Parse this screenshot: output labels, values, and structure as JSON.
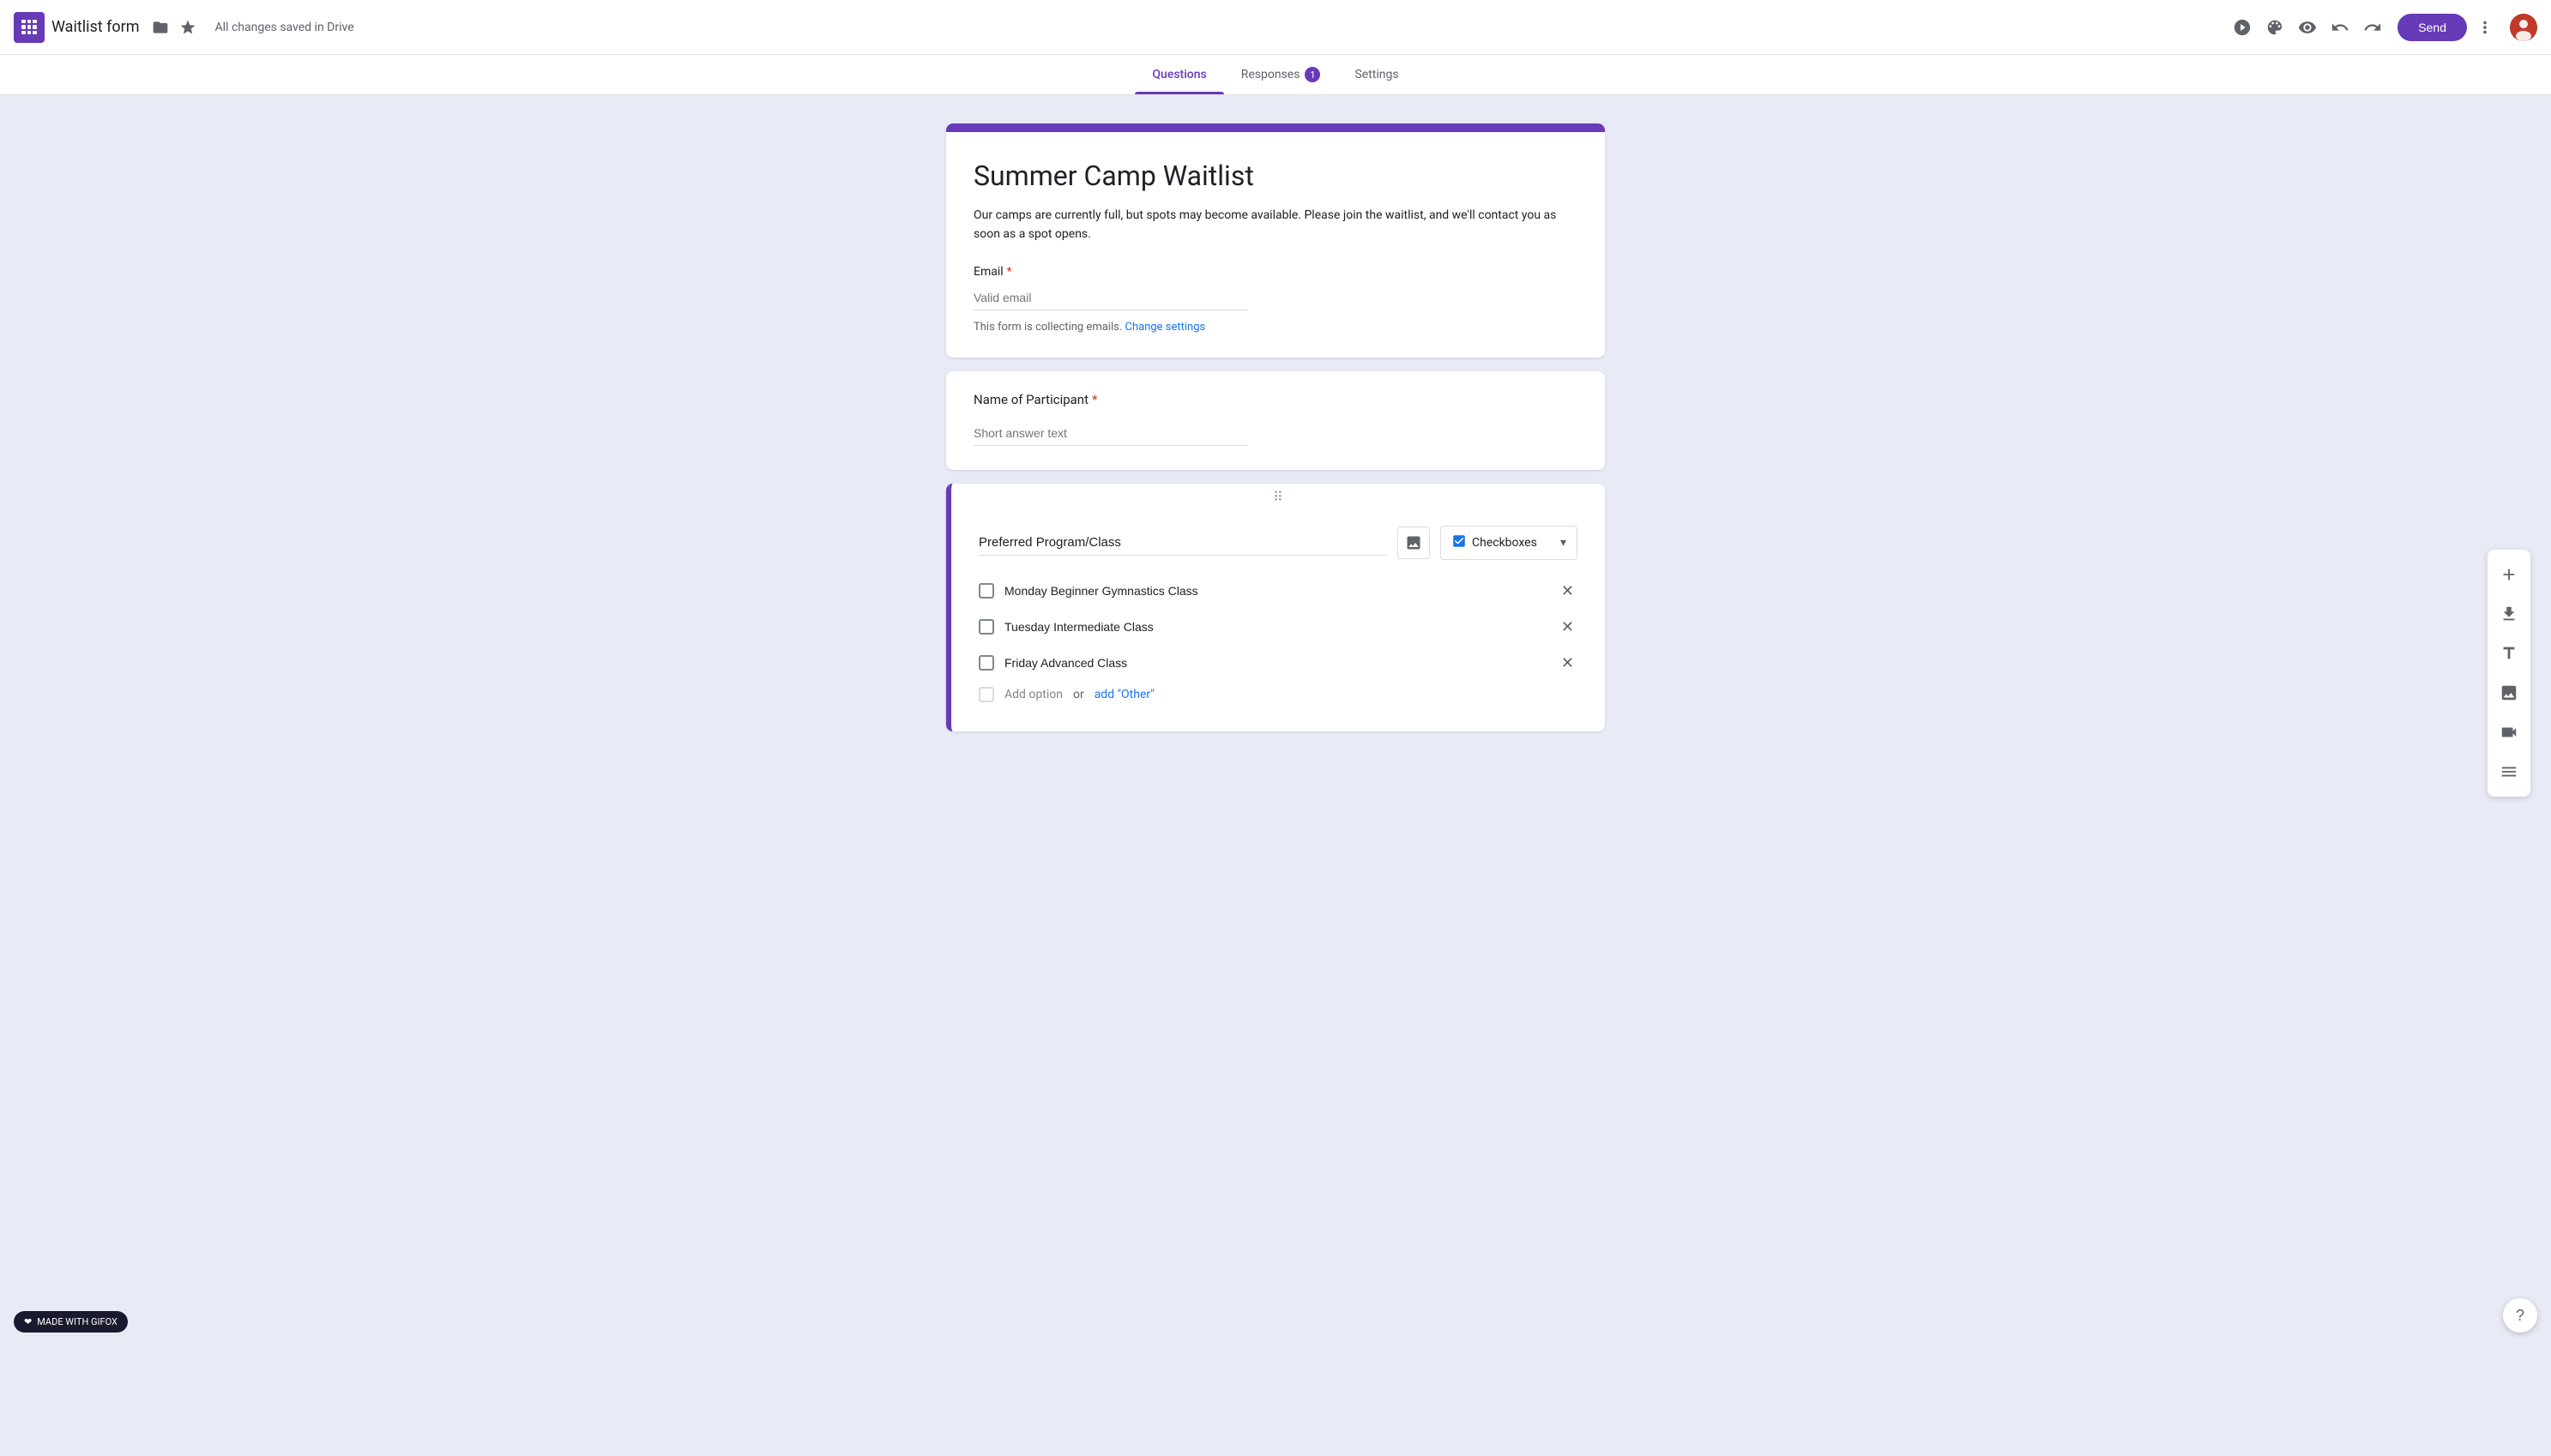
{
  "nav": {
    "logo_label": "Google Forms",
    "title": "Waitlist form",
    "saved_status": "All changes saved in Drive",
    "send_label": "Send",
    "more_options_label": "More options"
  },
  "tabs": [
    {
      "id": "questions",
      "label": "Questions",
      "active": true,
      "badge": null
    },
    {
      "id": "responses",
      "label": "Responses",
      "active": false,
      "badge": "1"
    },
    {
      "id": "settings",
      "label": "Settings",
      "active": false,
      "badge": null
    }
  ],
  "form": {
    "title": "Summer Camp Waitlist",
    "description": "Our camps are currently full, but spots may become available. Please join the waitlist, and we'll contact you as soon as a spot opens.",
    "email_label": "Email",
    "email_placeholder": "Valid email",
    "email_note": "This form is collecting emails.",
    "change_settings_link": "Change settings"
  },
  "questions": [
    {
      "id": "name",
      "label": "Name of Participant",
      "required": true,
      "type": "short_answer",
      "placeholder": "Short answer text"
    },
    {
      "id": "program",
      "label": "Preferred Program/Class",
      "required": false,
      "type": "checkboxes",
      "type_label": "Checkboxes",
      "options": [
        {
          "text": "Monday Beginner Gymnastics Class"
        },
        {
          "text": "Tuesday Intermediate Class"
        },
        {
          "text": "Friday Advanced Class"
        }
      ],
      "add_option_label": "Add option",
      "add_option_separator": "or",
      "add_other_label": "add \"Other\""
    }
  ],
  "sidebar_tools": [
    {
      "id": "add-question",
      "icon": "＋",
      "label": "Add question"
    },
    {
      "id": "import-questions",
      "icon": "⬇",
      "label": "Import questions"
    },
    {
      "id": "add-title",
      "icon": "Tt",
      "label": "Add title and description"
    },
    {
      "id": "add-image",
      "icon": "🖼",
      "label": "Add image"
    },
    {
      "id": "add-video",
      "icon": "▶",
      "label": "Add video"
    },
    {
      "id": "add-section",
      "icon": "☰",
      "label": "Add section"
    }
  ],
  "colors": {
    "brand": "#673ab7",
    "active_tab": "#673ab7"
  },
  "gifox_badge": "MADE WITH GIFOX"
}
